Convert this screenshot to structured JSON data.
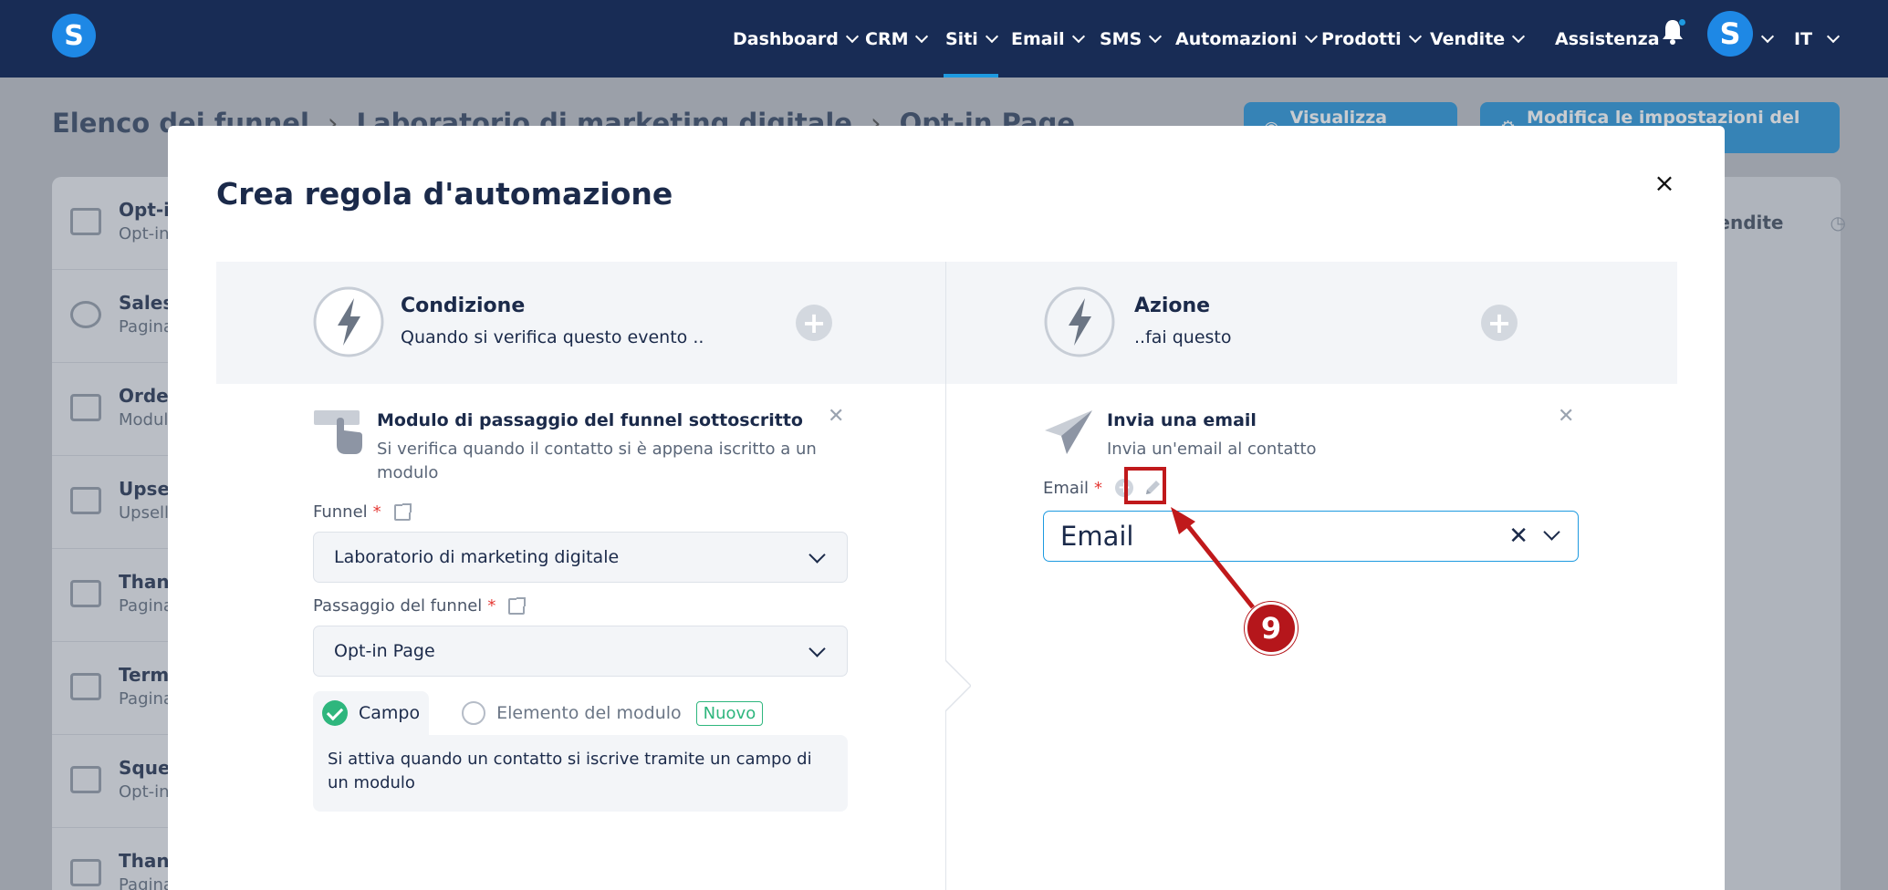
{
  "nav": {
    "logo": "S",
    "items": [
      {
        "label": "Dashboard"
      },
      {
        "label": "CRM"
      },
      {
        "label": "Siti"
      },
      {
        "label": "Email"
      },
      {
        "label": "SMS"
      },
      {
        "label": "Automazioni"
      },
      {
        "label": "Prodotti"
      },
      {
        "label": "Vendite"
      }
    ],
    "active": "Siti",
    "help": "Assistenza",
    "avatar": "S",
    "language": "IT"
  },
  "background": {
    "breadcrumb": [
      "Elenco dei funnel",
      "Laboratorio di marketing digitale",
      "Opt-in Page"
    ],
    "buttons": [
      "Visualizza funnel",
      "Modifica le impostazioni del Funnel"
    ],
    "sidebar": [
      {
        "title": "Opt-in Page",
        "sub": "Opt-in"
      },
      {
        "title": "Sales Page",
        "sub": "Pagina"
      },
      {
        "title": "Order Form",
        "sub": "Modulo"
      },
      {
        "title": "Upsell",
        "sub": "Upsell"
      },
      {
        "title": "Thank You",
        "sub": "Pagina"
      },
      {
        "title": "Terms",
        "sub": "Pagina"
      },
      {
        "title": "Squeeze",
        "sub": "Opt-in"
      },
      {
        "title": "Thank You",
        "sub": "Pagina"
      }
    ],
    "right_tab": "Vendite"
  },
  "modal": {
    "title": "Crea regola d'automazione",
    "close": "×",
    "condition": {
      "title": "Condizione",
      "subtitle": "Quando si verifica questo evento .."
    },
    "action": {
      "title": "Azione",
      "subtitle": "..fai questo"
    },
    "trigger_card": {
      "title": "Modulo di passaggio del funnel sottoscritto",
      "description": "Si verifica quando il contatto si è appena iscritto a un modulo",
      "funnel_label": "Funnel",
      "funnel_value": "Laboratorio di marketing digitale",
      "step_label": "Passaggio del funnel",
      "step_value": "Opt-in Page",
      "option_field": "Campo",
      "option_element": "Elemento del modulo",
      "badge_new": "Nuovo",
      "option_description": "Si attiva quando un contatto si iscrive tramite un campo di un modulo"
    },
    "action_card": {
      "title": "Invia una email",
      "description": "Invia un'email al contatto",
      "email_label": "Email",
      "email_value": "Email",
      "clear": "✕"
    },
    "required_mark": "*"
  },
  "annotation": {
    "step_number": "9",
    "color": "#c0191b"
  }
}
